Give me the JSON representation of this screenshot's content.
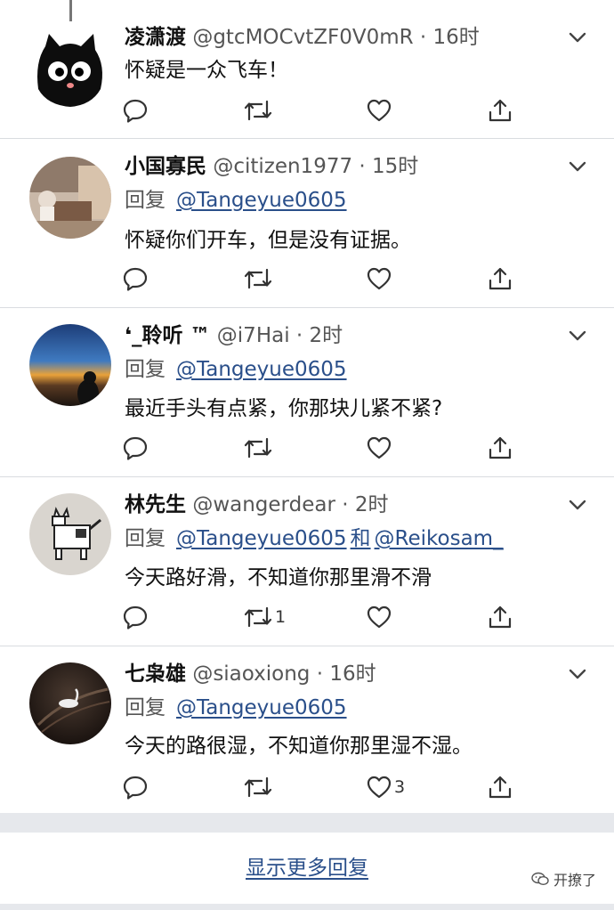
{
  "tweets": [
    {
      "name": "凌潇渡",
      "handle": "@gtcMOCvtZF0V0mR",
      "time": "16时",
      "reply_label": "",
      "mentions": [],
      "text": "怀疑是一众飞车！",
      "retweets": "",
      "likes": ""
    },
    {
      "name": "小国寡民",
      "handle": "@citizen1977",
      "time": "15时",
      "reply_label": "回复",
      "mentions": [
        "@Tangeyue0605"
      ],
      "text": "怀疑你们开车，但是没有证据。",
      "retweets": "",
      "likes": ""
    },
    {
      "name": "❛_聆听 ™",
      "handle": "@i7Hai",
      "time": "2时",
      "reply_label": "回复",
      "mentions": [
        "@Tangeyue0605"
      ],
      "text": "最近手头有点紧，你那块儿紧不紧?",
      "retweets": "",
      "likes": ""
    },
    {
      "name": "林先生",
      "handle": "@wangerdear",
      "time": "2时",
      "reply_label": "回复",
      "mentions": [
        "@Tangeyue0605",
        "@Reikosam_"
      ],
      "mention_join": "和",
      "text": "今天路好滑，不知道你那里滑不滑",
      "retweets": "1",
      "likes": ""
    },
    {
      "name": "七枭雄",
      "handle": "@siaoxiong",
      "time": "16时",
      "reply_label": "回复",
      "mentions": [
        "@Tangeyue0605"
      ],
      "text": "今天的路很湿，不知道你那里湿不湿。",
      "retweets": "",
      "likes": "3"
    }
  ],
  "separator": "·",
  "show_more": "显示更多回复",
  "watermark": "开撩了",
  "icons": [
    "reply-icon",
    "retweet-icon",
    "like-icon",
    "share-icon",
    "chevron-down-icon",
    "wechat-icon"
  ],
  "colors": {
    "link": "#2a4f8a",
    "divider": "#d9dce0",
    "strip": "#e6e8ec"
  }
}
